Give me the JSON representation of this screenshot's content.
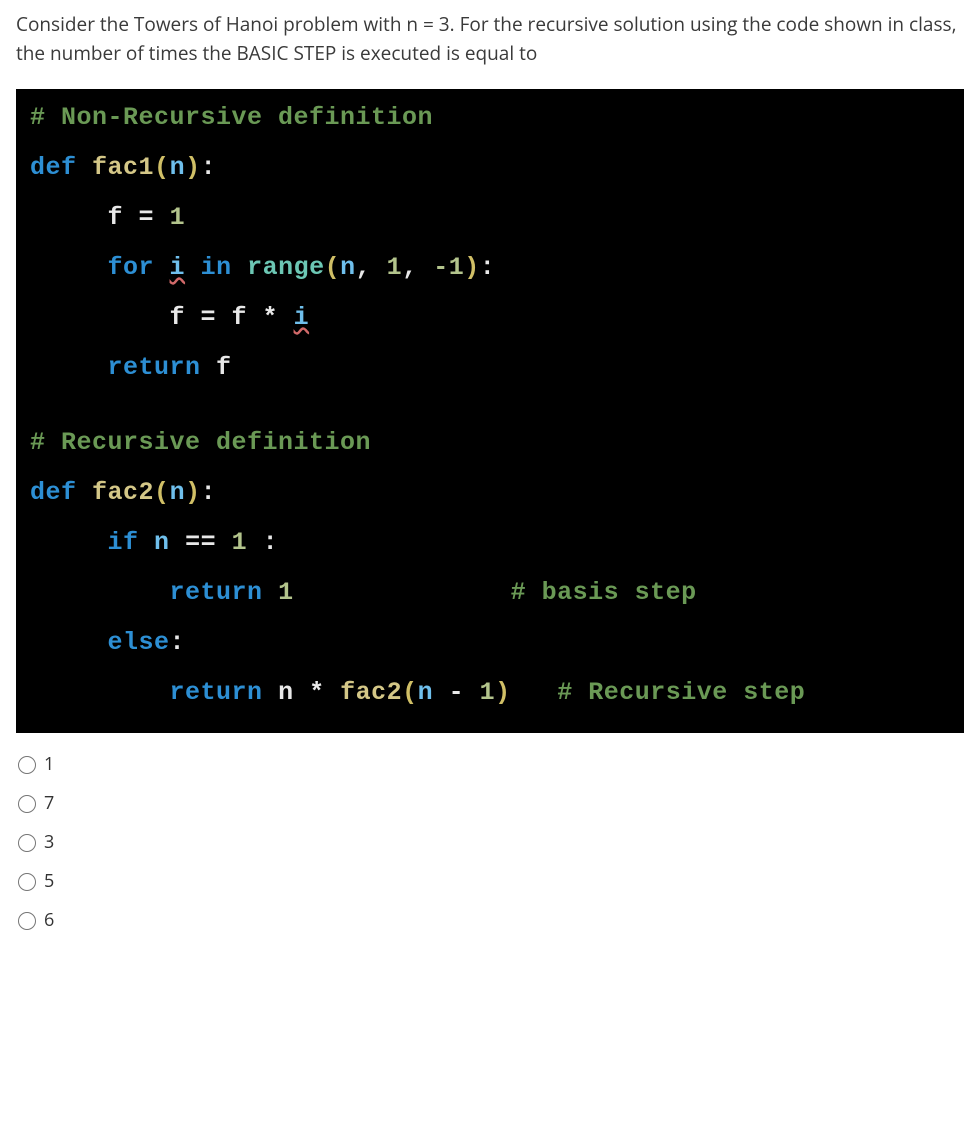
{
  "question": "Consider the Towers of Hanoi problem with n = 3. For the recursive solution using the code shown in class, the number of times the BASIC STEP is executed is equal to",
  "code": {
    "c1": "# Non-Recursive definition",
    "def": "def",
    "f1name": "fac1",
    "n": "n",
    "f_eq_1_lhs": "f = 1",
    "for": "for",
    "i": "i",
    "in": "in",
    "range": "range",
    "rargs_n": "n",
    "rargs_1": "1",
    "rargs_m1": "-1",
    "fmul": "f = f * ",
    "i2": "i",
    "return": "return",
    "f": "f",
    "c2": "# Recursive definition",
    "f2name": "fac2",
    "if": "if",
    "eq": " == ",
    "one": "1",
    "colon": " :",
    "ret1": "1",
    "cb": "# basis step",
    "else": "else",
    "retn": "n * ",
    "f2call": "fac2",
    "nm1_n": "n",
    "nm1_m": " - ",
    "nm1_1": "1",
    "cr": "# Recursive step"
  },
  "options": [
    {
      "label": "1"
    },
    {
      "label": "7"
    },
    {
      "label": "3"
    },
    {
      "label": "5"
    },
    {
      "label": "6"
    }
  ]
}
